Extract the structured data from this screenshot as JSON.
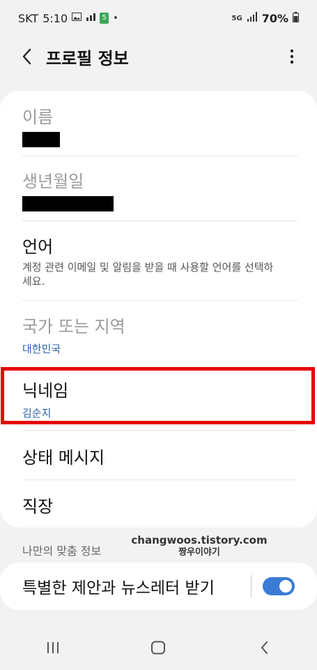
{
  "status_bar": {
    "carrier": "SKT",
    "time": "5:10",
    "network": "5G",
    "battery": "70%",
    "badge": "5"
  },
  "header": {
    "title": "프로필 정보"
  },
  "profile_rows": {
    "name_label": "이름",
    "birthday_label": "생년월일",
    "language_label": "언어",
    "language_desc": "계정 관련 이메일 및 알림을 받을 때 사용할 언어를 선택하세요.",
    "region_label": "국가 또는 지역",
    "region_value": "대한민국",
    "nickname_label": "닉네임",
    "nickname_value": "김순지",
    "status_message_label": "상태 메시지",
    "workplace_label": "직장"
  },
  "section": {
    "custom_info_label": "나만의 맞춤 정보"
  },
  "watermark": {
    "line1": "changwoos.tistory.com",
    "line2": "짱우이야기"
  },
  "marketing": {
    "label": "특별한 제안과 뉴스레터 받기",
    "enabled": true
  },
  "colors": {
    "accent": "#3a7bd5",
    "highlight": "#e60000",
    "value_text": "#2a5fa8"
  }
}
